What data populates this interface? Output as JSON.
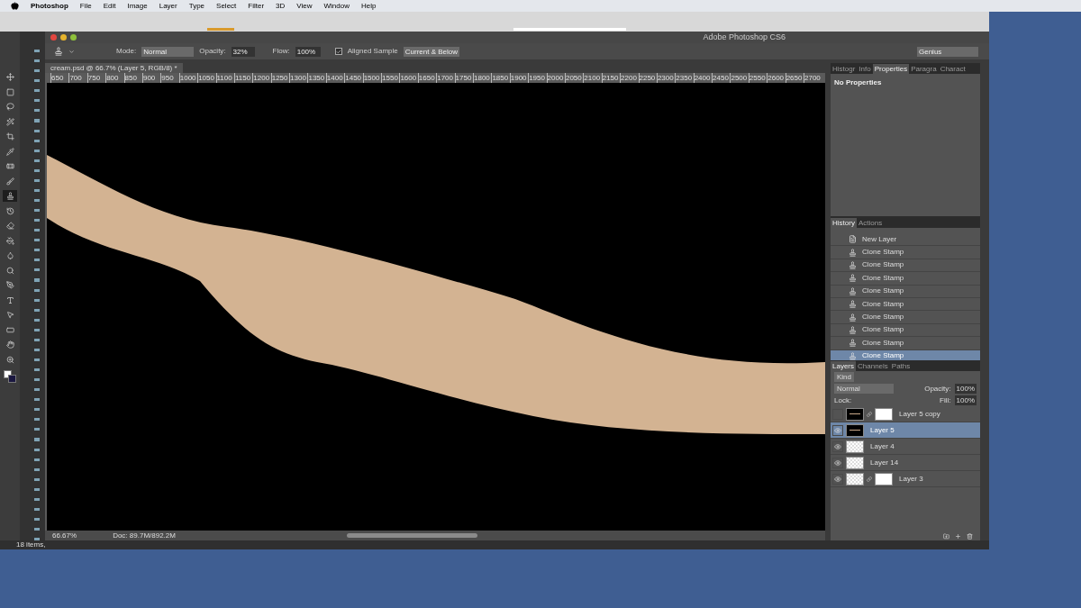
{
  "menu_bar": {
    "items": [
      "Photoshop",
      "File",
      "Edit",
      "Image",
      "Layer",
      "Type",
      "Select",
      "Filter",
      "3D",
      "View",
      "Window",
      "Help"
    ]
  },
  "window": {
    "title": "Adobe Photoshop CS6"
  },
  "tools": [
    {
      "kind": "move",
      "selected": false
    },
    {
      "kind": "marquee",
      "selected": false
    },
    {
      "kind": "lasso",
      "selected": false
    },
    {
      "kind": "wand",
      "selected": false
    },
    {
      "kind": "crop",
      "selected": false
    },
    {
      "kind": "eyedropper",
      "selected": false
    },
    {
      "kind": "heal",
      "selected": false
    },
    {
      "kind": "brush",
      "selected": false
    },
    {
      "kind": "stamp",
      "selected": true
    },
    {
      "kind": "history",
      "selected": false
    },
    {
      "kind": "eraser",
      "selected": false
    },
    {
      "kind": "bucket",
      "selected": false
    },
    {
      "kind": "blur",
      "selected": false
    },
    {
      "kind": "dodge",
      "selected": false
    },
    {
      "kind": "pen",
      "selected": false
    },
    {
      "kind": "type",
      "selected": false
    },
    {
      "kind": "path",
      "selected": false
    },
    {
      "kind": "shape",
      "selected": false
    },
    {
      "kind": "hand",
      "selected": false
    },
    {
      "kind": "zoom",
      "selected": false
    }
  ],
  "options_bar": {
    "mode_label": "Mode:",
    "mode": "Normal",
    "opacity_label": "Opacity:",
    "opacity": "32%",
    "flow_label": "Flow:",
    "flow": "100%",
    "aligned_label": "Aligned Sample",
    "aligned_checked": true,
    "sample": "Current & Below",
    "workspace": "Genius"
  },
  "document": {
    "tab": "cream.psd @ 66.7% (Layer 5, RGB/8) *",
    "ruler": [
      "650",
      "700",
      "750",
      "800",
      "850",
      "900",
      "950",
      "1000",
      "1050",
      "1100",
      "1150",
      "1200",
      "1250",
      "1300",
      "1350",
      "1400",
      "1450",
      "1500",
      "1550",
      "1600",
      "1650",
      "1700",
      "1750",
      "1800",
      "1850",
      "1900",
      "1950",
      "2000",
      "2050",
      "2100",
      "2150",
      "2200",
      "2250",
      "2300",
      "2350",
      "2400",
      "2450",
      "2500",
      "2550",
      "2600",
      "2650",
      "2700"
    ],
    "zoom": "66.67%",
    "doc_size": "Doc: 89.7M/892.2M"
  },
  "properties_panel": {
    "tabs": [
      {
        "label": "Histogr",
        "selected": false
      },
      {
        "label": "Info",
        "selected": false
      },
      {
        "label": "Properties",
        "selected": true
      },
      {
        "label": "Paragra",
        "selected": false
      },
      {
        "label": "Charact",
        "selected": false
      }
    ],
    "message": "No Properties"
  },
  "history_panel": {
    "tabs": [
      {
        "label": "History",
        "selected": true
      },
      {
        "label": "Actions",
        "selected": false
      }
    ],
    "items": [
      {
        "label": "New Layer",
        "kind": "layer",
        "selected": false
      },
      {
        "label": "Clone Stamp",
        "kind": "stamp",
        "selected": false
      },
      {
        "label": "Clone Stamp",
        "kind": "stamp",
        "selected": false
      },
      {
        "label": "Clone Stamp",
        "kind": "stamp",
        "selected": false
      },
      {
        "label": "Clone Stamp",
        "kind": "stamp",
        "selected": false
      },
      {
        "label": "Clone Stamp",
        "kind": "stamp",
        "selected": false
      },
      {
        "label": "Clone Stamp",
        "kind": "stamp",
        "selected": false
      },
      {
        "label": "Clone Stamp",
        "kind": "stamp",
        "selected": false
      },
      {
        "label": "Clone Stamp",
        "kind": "stamp",
        "selected": false
      },
      {
        "label": "Clone Stamp",
        "kind": "stamp",
        "selected": true
      }
    ]
  },
  "layers_panel": {
    "tabs": [
      {
        "label": "Layers",
        "selected": true
      },
      {
        "label": "Channels",
        "selected": false
      },
      {
        "label": "Paths",
        "selected": false
      }
    ],
    "filter": "Kind",
    "blend": "Normal",
    "opacity_label": "Opacity:",
    "opacity": "100%",
    "lock_label": "Lock:",
    "fill_label": "Fill:",
    "fill": "100%",
    "layers": [
      {
        "name": "Layer 5 copy",
        "visible": false,
        "thumb": {
          "kind": "dark"
        },
        "mask": true,
        "selected": false
      },
      {
        "name": "Layer 5",
        "visible": true,
        "thumb": {
          "kind": "dark"
        },
        "mask": false,
        "selected": true
      },
      {
        "name": "Layer 4",
        "visible": true,
        "thumb": {
          "kind": "checker"
        },
        "mask": false,
        "selected": false
      },
      {
        "name": "Layer 14",
        "visible": true,
        "thumb": {
          "kind": "checker"
        },
        "mask": false,
        "selected": false
      },
      {
        "name": "Layer 3",
        "visible": true,
        "thumb": {
          "kind": "checker"
        },
        "mask": true,
        "selected": false
      }
    ]
  },
  "bridge_status": "18 items,"
}
